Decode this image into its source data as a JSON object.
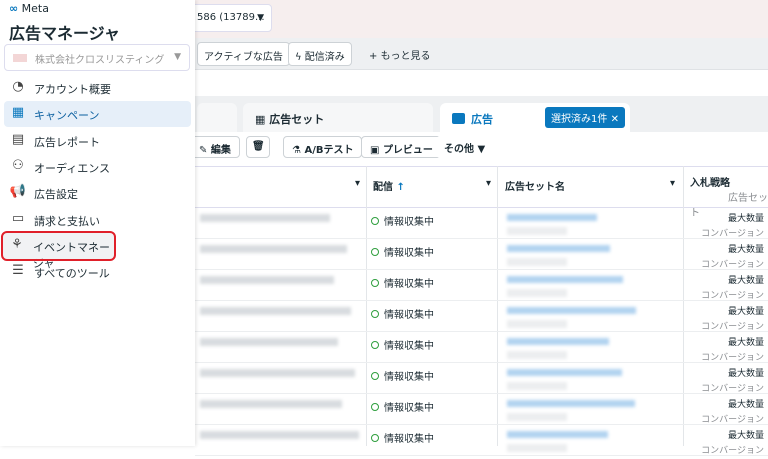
{
  "sidebar": {
    "brand": "Meta",
    "title": "広告マネージャ",
    "account": "株式会社クロスリスティング",
    "items": [
      {
        "label": "アカウント概要",
        "icon": "gauge-icon"
      },
      {
        "label": "キャンペーン",
        "icon": "table-icon",
        "active": true
      },
      {
        "label": "広告レポート",
        "icon": "report-icon"
      },
      {
        "label": "オーディエンス",
        "icon": "audience-icon"
      },
      {
        "label": "広告設定",
        "icon": "megaphone-icon"
      },
      {
        "label": "請求と支払い",
        "icon": "card-icon"
      },
      {
        "label": "イベントマネージャ",
        "icon": "events-icon",
        "highlighted": true
      },
      {
        "label": "すべてのツール",
        "icon": "menu-icon"
      }
    ]
  },
  "header": {
    "account_id": "586 (13789..."
  },
  "filters": {
    "active_ads": "アクティブな広告",
    "delivered": "配信済み",
    "more": "もっと見る"
  },
  "tabs": {
    "adset": "広告セット",
    "ad": "広告",
    "selected": "選択済み1件"
  },
  "toolbar": {
    "edit": "編集",
    "ab_test": "A/Bテスト",
    "preview": "プレビュー",
    "other": "その他"
  },
  "table": {
    "columns": {
      "delivery": "配信",
      "adset_name": "広告セット名",
      "bid": "入札戦略",
      "bid_sub": "広告セット"
    },
    "rows": [
      {
        "status": "情報収集中",
        "bid": "最大数量",
        "bid_sub": "コンバージョン"
      },
      {
        "status": "情報収集中",
        "bid": "最大数量",
        "bid_sub": "コンバージョン"
      },
      {
        "status": "情報収集中",
        "bid": "最大数量",
        "bid_sub": "コンバージョン"
      },
      {
        "status": "情報収集中",
        "bid": "最大数量",
        "bid_sub": "コンバージョン"
      },
      {
        "status": "情報収集中",
        "bid": "最大数量",
        "bid_sub": "コンバージョン"
      },
      {
        "status": "情報収集中",
        "bid": "最大数量",
        "bid_sub": "コンバージョン"
      },
      {
        "status": "情報収集中",
        "bid": "最大数量",
        "bid_sub": "コンバージョン"
      },
      {
        "status": "情報収集中",
        "bid": "最大数量",
        "bid_sub": "コンバージョン"
      }
    ]
  },
  "colors": {
    "accent": "#0a78be",
    "active_bg": "#e6eff9",
    "highlight_border": "#e0202a",
    "status_green": "#2e9e3d"
  }
}
